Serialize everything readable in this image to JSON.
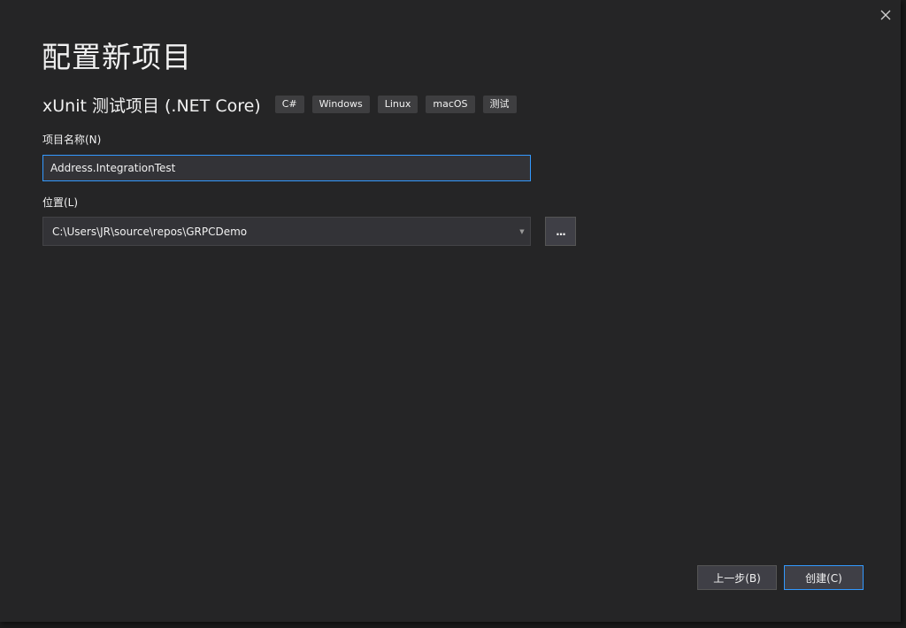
{
  "dialog": {
    "title": "配置新项目",
    "close_icon": "close-icon"
  },
  "template": {
    "name": "xUnit 测试项目 (.NET Core)",
    "tags": [
      "C#",
      "Windows",
      "Linux",
      "macOS",
      "测试"
    ]
  },
  "project_name": {
    "label": "项目名称(N)",
    "value": "Address.IntegrationTest"
  },
  "location": {
    "label": "位置(L)",
    "value": "C:\\Users\\JR\\source\\repos\\GRPCDemo",
    "browse_label": "..."
  },
  "footer": {
    "back_label": "上一步(B)",
    "create_label": "创建(C)"
  },
  "colors": {
    "background": "#252526",
    "accent": "#3399ff",
    "text": "#f1f1f1",
    "tag_bg": "#3e3e40"
  }
}
